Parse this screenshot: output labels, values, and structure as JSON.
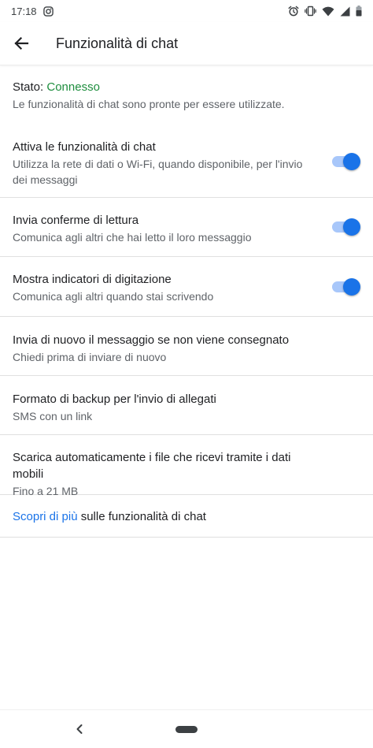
{
  "status_bar": {
    "time": "17:18"
  },
  "app_bar": {
    "title": "Funzionalità di chat"
  },
  "status": {
    "label": "Stato:",
    "value": "Connesso",
    "description": "Le funzionalità di chat sono pronte per essere utilizzate."
  },
  "settings": [
    {
      "title": "Attiva le funzionalità di chat",
      "subtitle": "Utilizza la rete di dati o Wi-Fi, quando disponibile, per l'invio dei messaggi",
      "toggle_on": true
    },
    {
      "title": "Invia conferme di lettura",
      "subtitle": "Comunica agli altri che hai letto il loro messaggio",
      "toggle_on": true
    },
    {
      "title": "Mostra indicatori di digitazione",
      "subtitle": "Comunica agli altri quando stai scrivendo",
      "toggle_on": true
    },
    {
      "title": "Invia di nuovo il messaggio se non viene consegnato",
      "subtitle": "Chiedi prima di inviare di nuovo"
    },
    {
      "title": "Formato di backup per l'invio di allegati",
      "subtitle": "SMS con un link"
    },
    {
      "title": "Scarica automaticamente i file che ricevi tramite i dati mobili",
      "subtitle": "Fino a 21 MB"
    }
  ],
  "learn_more": {
    "link_text": "Scopri di più",
    "rest_text": " sulle funzionalità di chat"
  },
  "colors": {
    "accent": "#1a73e8",
    "connected": "#1e8e3e",
    "toggle_track": "#a8c7fa"
  },
  "icons": {
    "status_left": [
      "instagram-icon"
    ],
    "status_right": [
      "alarm-icon",
      "vibrate-icon",
      "wifi-icon",
      "signal-icon",
      "battery-icon"
    ],
    "app_bar": "back-arrow-icon",
    "nav": [
      "nav-back-icon",
      "nav-home-pill"
    ]
  }
}
